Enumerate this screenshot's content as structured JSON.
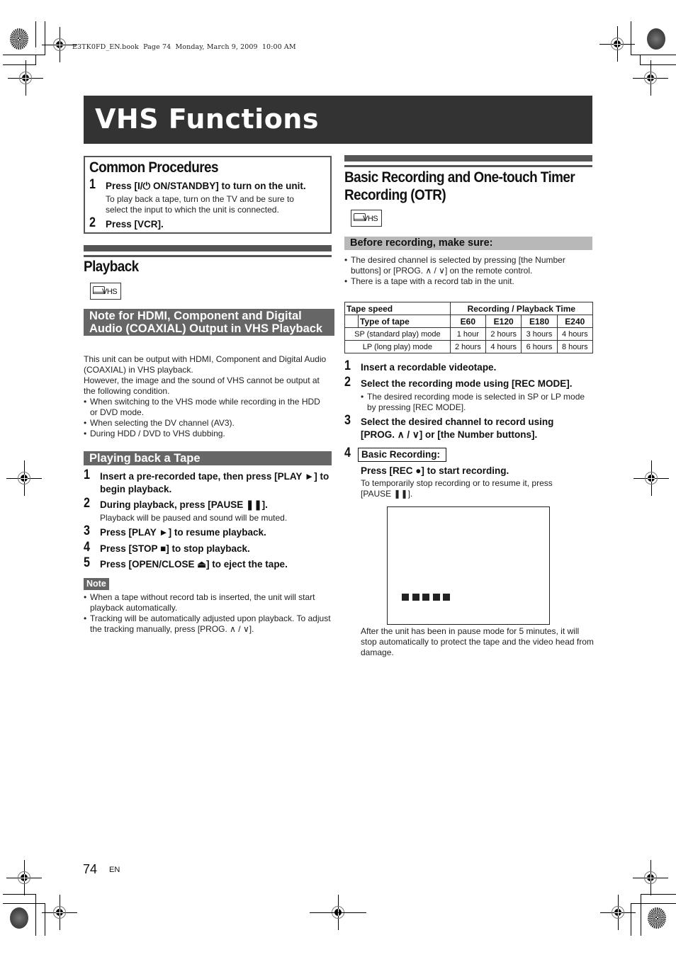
{
  "print_header": "E3TK0FD_EN.book  Page 74  Monday, March 9, 2009  10:00 AM",
  "page_title": "VHS Functions",
  "common_procedures": {
    "heading": "Common Procedures",
    "steps": [
      {
        "num": "1",
        "text": "Press [I/⏻ ON/STANDBY] to turn on the unit.",
        "detail": "To play back a tape, turn on the TV and be sure to select the input to which the unit is connected."
      },
      {
        "num": "2",
        "text": "Press [VCR]."
      }
    ]
  },
  "playback": {
    "heading": "Playback",
    "icon_label": "VHS",
    "note_heading": "Note for HDMI, Component and Digital Audio (COAXIAL) Output in VHS Playback",
    "note_para1": "This unit can be output with HDMI, Component and Digital Audio (COAXIAL) in VHS playback.",
    "note_para2": "However, the image and the sound of VHS cannot be output at the following condition.",
    "note_bullets": [
      "When switching to the VHS mode while recording in the HDD or DVD mode.",
      "When selecting the DV channel (AV3).",
      "During HDD / DVD to VHS dubbing."
    ],
    "tape_heading": "Playing back a Tape",
    "tape_steps": [
      {
        "num": "1",
        "text": "Insert a pre-recorded tape, then press [PLAY ►] to begin playback."
      },
      {
        "num": "2",
        "text": "During playback, press [PAUSE ❚❚].",
        "detail": "Playback will be paused and sound will be muted."
      },
      {
        "num": "3",
        "text": "Press [PLAY ►] to resume playback."
      },
      {
        "num": "4",
        "text": "Press [STOP ■] to stop playback."
      },
      {
        "num": "5",
        "text": "Press [OPEN/CLOSE ⏏] to eject the tape."
      }
    ],
    "note_label": "Note",
    "notes": [
      "When a tape without record tab is inserted, the unit will start playback automatically.",
      "Tracking will be automatically adjusted upon playback. To adjust the tracking manually, press [PROG. ∧ / ∨]."
    ]
  },
  "recording": {
    "heading": "Basic Recording and One-touch Timer Recording (OTR)",
    "icon_label": "VHS",
    "before_heading": "Before recording, make sure:",
    "before_bullets": [
      "The desired channel is selected by pressing [the Number buttons] or [PROG. ∧ / ∨] on the remote control.",
      "There is a tape with a record tab in the unit."
    ],
    "table": {
      "header_speed": "Tape speed",
      "header_time": "Recording / Playback Time",
      "header_type": "Type of tape",
      "columns": [
        "E60",
        "E120",
        "E180",
        "E240"
      ],
      "rows": [
        {
          "label": "SP (standard play) mode",
          "values": [
            "1 hour",
            "2 hours",
            "3 hours",
            "4 hours"
          ]
        },
        {
          "label": "LP (long play) mode",
          "values": [
            "2 hours",
            "4 hours",
            "6 hours",
            "8 hours"
          ]
        }
      ]
    },
    "steps": [
      {
        "num": "1",
        "text": "Insert a recordable videotape."
      },
      {
        "num": "2",
        "text": "Select the recording mode using [REC MODE].",
        "detail": "The desired recording mode is selected in SP or LP mode by pressing [REC MODE]."
      },
      {
        "num": "3",
        "text": "Select the desired channel to record using [PROG. ∧ / ∨] or [the Number buttons]."
      },
      {
        "num": "4",
        "boxed": "Basic Recording:",
        "text": "Press [REC ●] to start recording.",
        "detail": "To temporarily stop recording or to resume it, press [PAUSE ❚❚]."
      }
    ],
    "screen_blocks": 5,
    "after_text": "After the unit has been in pause mode for 5 minutes, it will stop automatically to protect the tape and the video head from damage."
  },
  "footer": {
    "page_number": "74",
    "language": "EN"
  }
}
